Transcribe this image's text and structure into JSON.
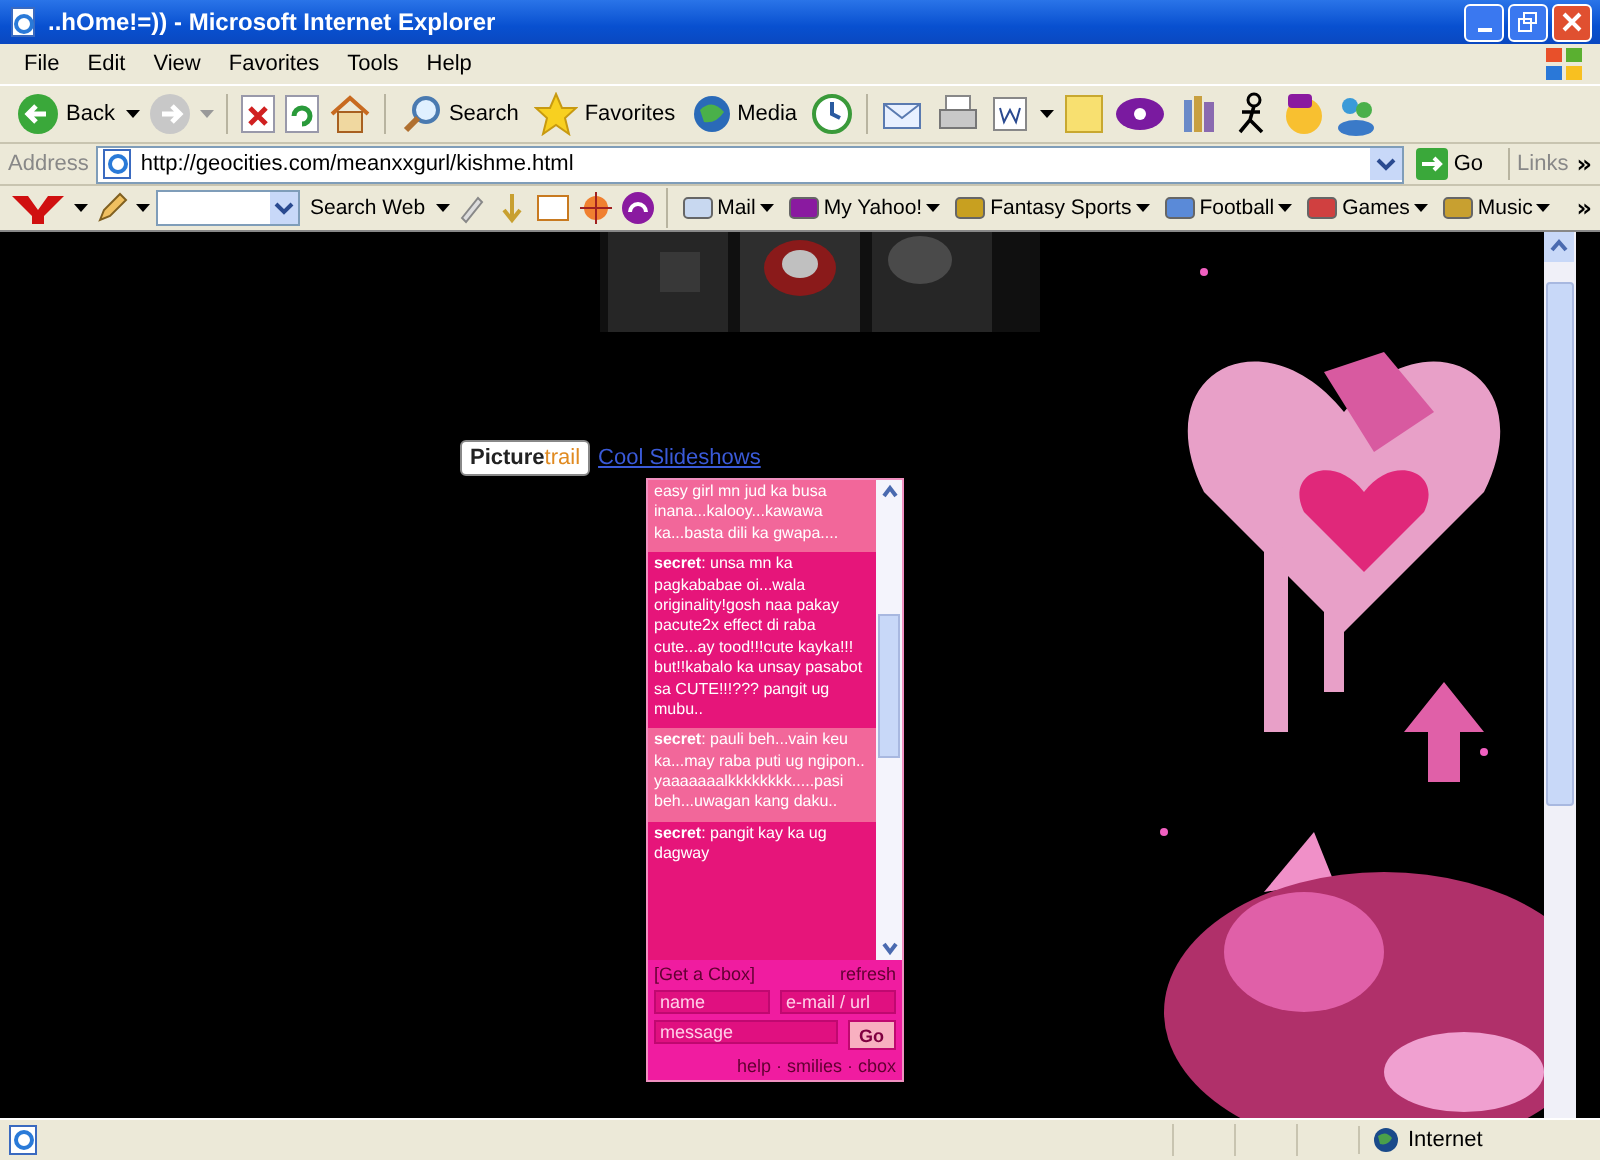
{
  "window": {
    "title": "..hOme!=)) - Microsoft Internet Explorer"
  },
  "menu": [
    "File",
    "Edit",
    "View",
    "Favorites",
    "Tools",
    "Help"
  ],
  "toolbar": {
    "back": "Back",
    "search": "Search",
    "favorites": "Favorites",
    "media": "Media"
  },
  "address": {
    "label": "Address",
    "url": "http://geocities.com/meanxxgurl/kishme.html",
    "go": "Go",
    "links": "Links",
    "more": "»"
  },
  "yahoo_bar": {
    "search_button": "Search Web",
    "items": [
      "Mail",
      "My Yahoo!",
      "Fantasy Sports",
      "Football",
      "Games",
      "Music"
    ],
    "more": "»"
  },
  "page": {
    "picturetrail": {
      "logo_a": "Picture",
      "logo_b": "trail",
      "link": "Cool Slideshows"
    },
    "cbox": {
      "messages": [
        {
          "shaded": false,
          "text": "easy girl mn jud ka busa inana...kalooy...kawawa ka...basta dili ka gwapa...."
        },
        {
          "shaded": true,
          "text": "**secret**: unsa mn ka pagkababae oi...wala originality!gosh naa pakay pacute2x effect di raba cute...ay tood!!!cute kayka!!! but!!kabalo ka unsay pasabot sa CUTE!!!??? pangit ug mubu.."
        },
        {
          "shaded": false,
          "text": "**secret**: pauli beh...vain keu ka...may raba puti ug ngipon.. yaaaaaaalkkkkkkkk.....pasi beh...uwagan kang daku.."
        },
        {
          "shaded": true,
          "text": "**secret**: pangit kay ka ug dagway"
        }
      ],
      "get_link": "[Get a Cbox]",
      "refresh": "refresh",
      "name_placeholder": "name",
      "email_placeholder": "e-mail / url",
      "message_placeholder": "message",
      "go": "Go",
      "footer": "help · smilies · cbox"
    }
  },
  "status_bar": {
    "zone": "Internet"
  }
}
